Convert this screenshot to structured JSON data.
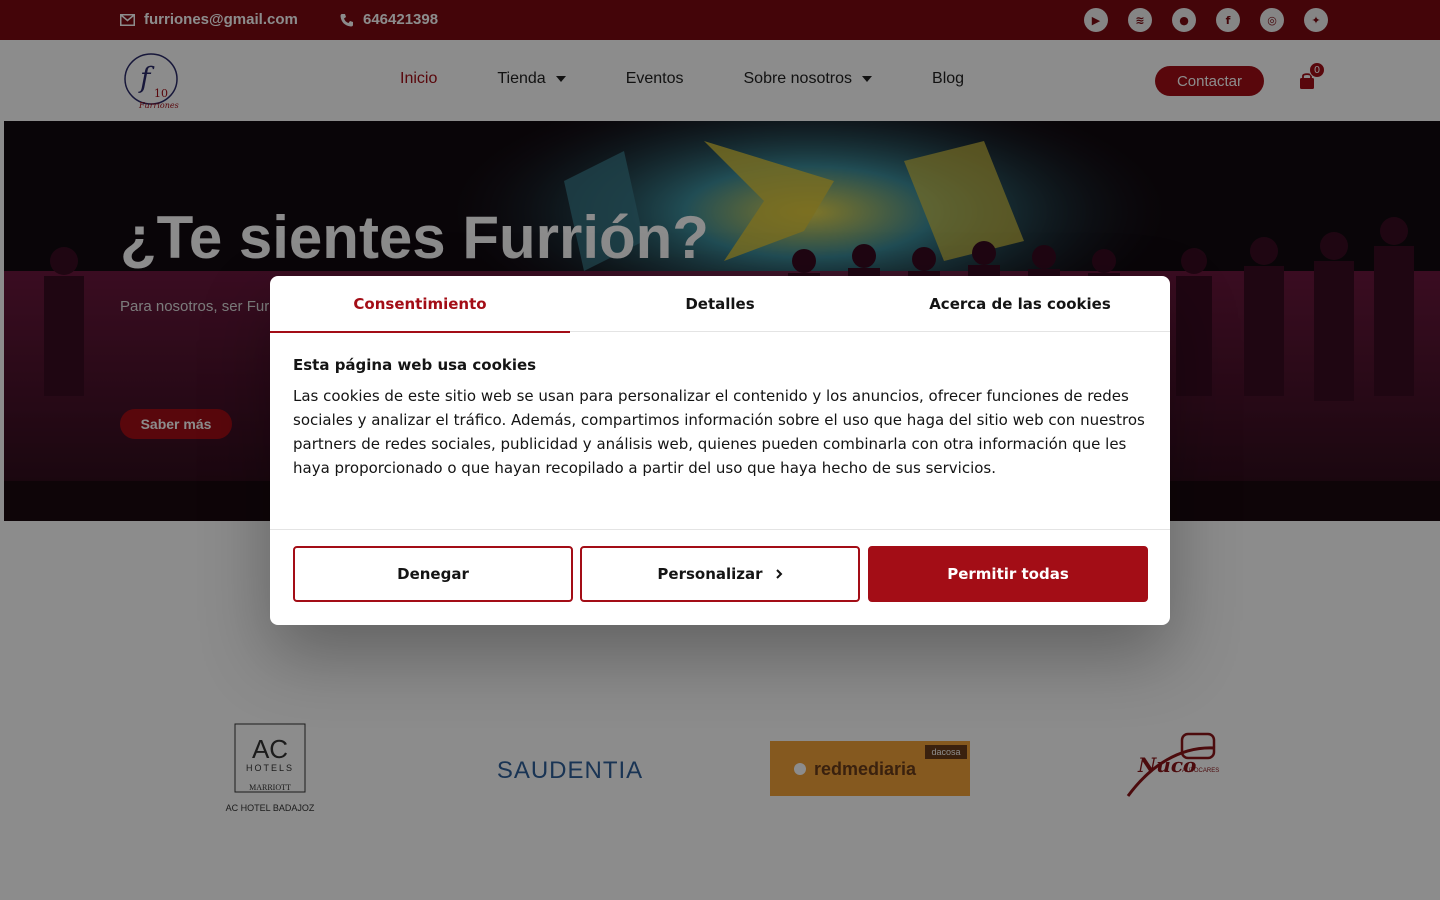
{
  "topbar": {
    "email": "furriones@gmail.com",
    "phone": "646421398",
    "socials": [
      {
        "icon": "youtube-icon",
        "glyph": "▶"
      },
      {
        "icon": "spotify-icon",
        "glyph": "≋"
      },
      {
        "icon": "apple-icon",
        "glyph": "●"
      },
      {
        "icon": "facebook-icon",
        "glyph": "f"
      },
      {
        "icon": "instagram-icon",
        "glyph": "◎"
      },
      {
        "icon": "twitter-icon",
        "glyph": "✦"
      }
    ]
  },
  "nav": {
    "items": [
      {
        "label": "Inicio",
        "active": true,
        "dropdown": false
      },
      {
        "label": "Tienda",
        "active": false,
        "dropdown": true
      },
      {
        "label": "Eventos",
        "active": false,
        "dropdown": false
      },
      {
        "label": "Sobre nosotros",
        "active": false,
        "dropdown": true
      },
      {
        "label": "Blog",
        "active": false,
        "dropdown": false
      }
    ],
    "contact_label": "Contactar",
    "cart_count": "0"
  },
  "hero": {
    "title": "¿Te sientes Furrión?",
    "text": "Para nosotros, ser Furr bellas que esta le brin placer que nos ofrece",
    "button_label": "Saber más"
  },
  "sponsors": {
    "ac_hotels": {
      "main": "AC",
      "sub": "HOTELS",
      "brand": "MARRIOTT",
      "caption": "AC HOTEL BADAJOZ"
    },
    "saudentia": "SAUDENTIA",
    "redmediaria": {
      "name": "redmediaria",
      "tag": "dacosa"
    },
    "nuco": {
      "name": "Nuco",
      "tag": "AUTOCARES"
    }
  },
  "cookie_dialog": {
    "tabs": [
      "Consentimiento",
      "Detalles",
      "Acerca de las cookies"
    ],
    "heading": "Esta página web usa cookies",
    "body": "Las cookies de este sitio web se usan para personalizar el contenido y los anuncios, ofrecer funciones de redes sociales y analizar el tráfico. Además, compartimos información sobre el uso que haga del sitio web con nuestros partners de redes sociales, publicidad y análisis web, quienes pueden combinarla con otra información que les haya proporcionado o que hayan recopilado a partir del uso que haya hecho de sus servicios.",
    "deny_label": "Denegar",
    "customize_label": "Personalizar",
    "allow_label": "Permitir todas"
  },
  "colors": {
    "brand": "#a30d16",
    "topbar": "#7d0a12"
  }
}
